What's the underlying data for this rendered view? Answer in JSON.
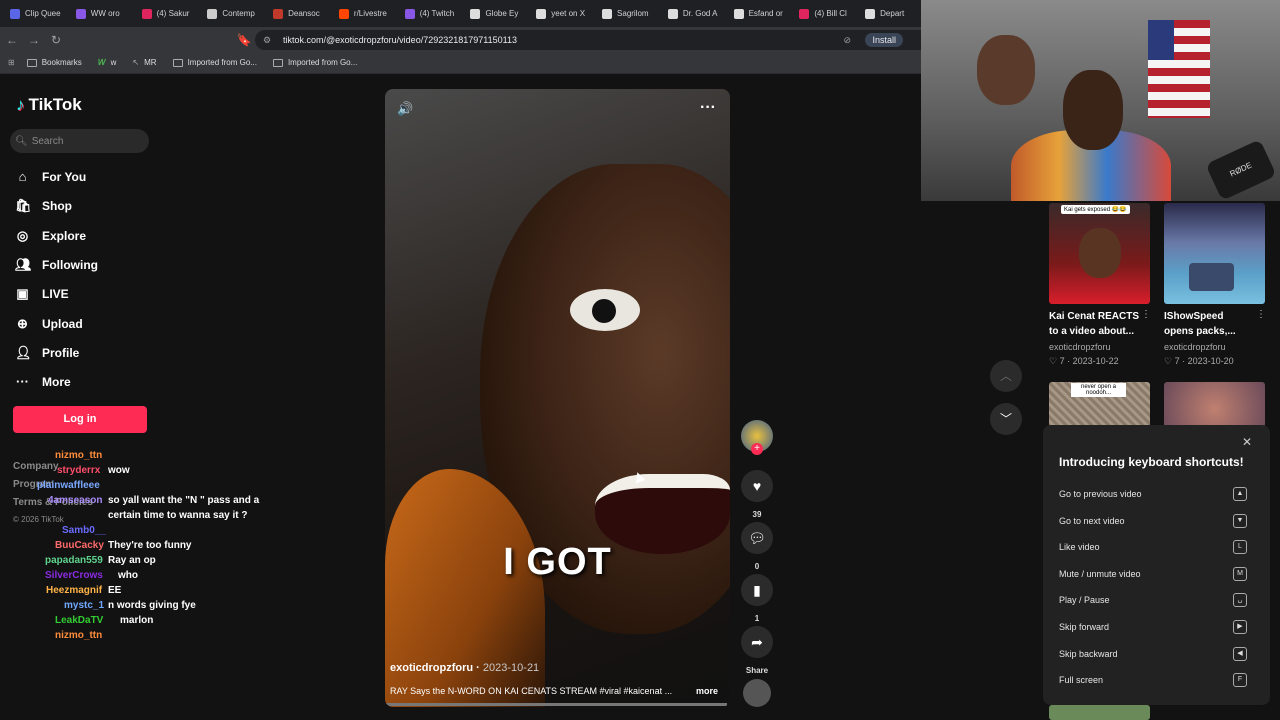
{
  "browser": {
    "tabs": [
      {
        "label": "Clip Quee",
        "color": "#5a66e8",
        "icon": "clip-icon"
      },
      {
        "label": "WW oro",
        "color": "#8957e5",
        "icon": "twitch-icon"
      },
      {
        "label": "(4) Sakur",
        "color": "#e0245e",
        "icon": "youtube-icon"
      },
      {
        "label": "Contemp",
        "color": "#cccccc",
        "icon": "page-icon"
      },
      {
        "label": "Deansoc",
        "color": "#c0392b",
        "icon": "chart-icon"
      },
      {
        "label": "r/Livestre",
        "color": "#ff4500",
        "icon": "reddit-icon"
      },
      {
        "label": "(4) Twitch",
        "color": "#8957e5",
        "icon": "twitch-icon"
      },
      {
        "label": "Globe Ey",
        "color": "#dddddd",
        "icon": "x-icon"
      },
      {
        "label": "yeet on X",
        "color": "#dddddd",
        "icon": "x-icon"
      },
      {
        "label": "Sagrilom",
        "color": "#dddddd",
        "icon": "x-icon"
      },
      {
        "label": "Dr. God A",
        "color": "#dddddd",
        "icon": "x-icon"
      },
      {
        "label": "Esfand or",
        "color": "#dddddd",
        "icon": "x-icon"
      },
      {
        "label": "(4) Bill Cl",
        "color": "#e0245e",
        "icon": "youtube-icon"
      },
      {
        "label": "Depart",
        "color": "#dddddd",
        "icon": "x-icon"
      }
    ],
    "url": "tiktok.com/@exoticdropzforu/video/7292321817971150113",
    "install_label": "Install",
    "bookmarks": [
      "Bookmarks",
      "w",
      "MR",
      "Imported from Go...",
      "Imported from Go..."
    ]
  },
  "sidebar": {
    "logo": "TikTok",
    "search_placeholder": "Search",
    "nav": [
      {
        "label": "For You",
        "icon": "home-icon"
      },
      {
        "label": "Shop",
        "icon": "shop-icon"
      },
      {
        "label": "Explore",
        "icon": "compass-icon"
      },
      {
        "label": "Following",
        "icon": "following-icon"
      },
      {
        "label": "LIVE",
        "icon": "live-icon"
      },
      {
        "label": "Upload",
        "icon": "upload-icon"
      },
      {
        "label": "Profile",
        "icon": "profile-icon"
      },
      {
        "label": "More",
        "icon": "more-icon"
      }
    ],
    "login_label": "Log in",
    "footer_links": [
      "Company",
      "Program",
      "Terms & Policies"
    ],
    "copyright": "© 2026 TikTok"
  },
  "chat": [
    {
      "user": "nizmo_ttn",
      "color": "#ff8c3a",
      "msg": ""
    },
    {
      "user": "stryderrx",
      "color": "#ff4d6a",
      "msg": "wow"
    },
    {
      "user": "plainwaffleee",
      "color": "#7aa7ff",
      "msg": ""
    },
    {
      "user": "4amseason",
      "color": "#a78bfa",
      "msg": "so yall want the \"N \" pass and a"
    },
    {
      "user": "",
      "color": "#ffffff",
      "msg": "certain time to wanna say it ?"
    },
    {
      "user": "Samb0__",
      "color": "#6a6aff",
      "msg": ""
    },
    {
      "user": "BuuCacky",
      "color": "#ff6b6b",
      "msg": "They're too funny"
    },
    {
      "user": "papadan559",
      "color": "#5fd38d",
      "msg": "Ray an op"
    },
    {
      "user": "SilverCrows",
      "color": "#8a2be2",
      "msg": "who"
    },
    {
      "user": "Heezmagnif",
      "color": "#ffb347",
      "msg": "EE"
    },
    {
      "user": "mystc_1",
      "color": "#6fa8ff",
      "msg": "n words giving fye"
    },
    {
      "user": "LeakDaTV",
      "color": "#32cd32",
      "msg": "marlon"
    },
    {
      "user": "nizmo_ttn",
      "color": "#ff8c3a",
      "msg": ""
    }
  ],
  "video": {
    "caption": "I GOT",
    "author": "exoticdropzforu",
    "date": "2023-10-21",
    "description": "RAY Says the N-WORD ON KAI CENATS STREAM #viral #kaicenat ...",
    "more_label": "more"
  },
  "actions": {
    "likes": "39",
    "comments": "0",
    "saves": "1",
    "share_label": "Share"
  },
  "related": [
    {
      "title_1": "Kai Cenat REACTS",
      "title_2": "to a video about...",
      "author": "exoticdropzforu",
      "likes": "7",
      "date": "2023-10-22",
      "overlay": "Kai gets exposed 😂😂"
    },
    {
      "title_1": "IShowSpeed",
      "title_2": "opens packs,...",
      "author": "exoticdropzforu",
      "likes": "7",
      "date": "2023-10-20",
      "overlay": ""
    }
  ],
  "related_overlay_2": "never open a noodoh...",
  "keyboard": {
    "title": "Introducing keyboard shortcuts!",
    "rows": [
      {
        "label": "Go to previous video",
        "key": "▲"
      },
      {
        "label": "Go to next video",
        "key": "▼"
      },
      {
        "label": "Like video",
        "key": "L"
      },
      {
        "label": "Mute / unmute video",
        "key": "M"
      },
      {
        "label": "Play / Pause",
        "key": "␣"
      },
      {
        "label": "Skip forward",
        "key": "▶"
      },
      {
        "label": "Skip backward",
        "key": "◀"
      },
      {
        "label": "Full screen",
        "key": "F"
      }
    ]
  },
  "webcam": {
    "mic_brand": "RØDE"
  }
}
